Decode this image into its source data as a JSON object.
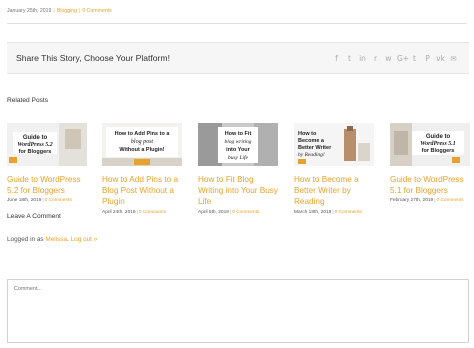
{
  "post_meta": {
    "date": "January 25th, 2019",
    "category": "Blogging",
    "comments": "0 Comments"
  },
  "share": {
    "title": "Share This Story, Choose Your Platform!",
    "icons": [
      "facebook-icon",
      "twitter-icon",
      "linkedin-icon",
      "reddit-icon",
      "whatsapp-icon",
      "google-plus-icon",
      "tumblr-icon",
      "pinterest-icon",
      "vk-icon",
      "email-icon"
    ],
    "icon_glyphs": [
      "f",
      "t",
      "in",
      "r",
      "w",
      "G+",
      "t",
      "P",
      "vk",
      "✉"
    ]
  },
  "related": {
    "title": "Related Posts",
    "posts": [
      {
        "title": "Guide to WordPress 5.2 for Bloggers",
        "date": "June 18th, 2019",
        "comments": "0 Comments",
        "thumb_lines": [
          "Guide to",
          "WordPress 5.2",
          "for Bloggers"
        ]
      },
      {
        "title": "How to Add Pins to a Blog Post Without a Plugin",
        "date": "April 24th, 2019",
        "comments": "0 Comments",
        "thumb_lines": [
          "How to Add Pins to a",
          "blog post",
          "Without a Plugin!"
        ]
      },
      {
        "title": "How to Fit Blog Writing into Your Busy Life",
        "date": "April 5th, 2019",
        "comments": "0 Comments",
        "thumb_lines": [
          "How to Fit",
          "blog writing",
          "into Your",
          "busy Life"
        ]
      },
      {
        "title": "How to Become a Better Writer by Reading",
        "date": "March 18th, 2019",
        "comments": "0 Comments",
        "thumb_lines": [
          "How to",
          "Become a",
          "Better Writer",
          "by Reading!"
        ]
      },
      {
        "title": "Guide to WordPress 5.1 for Bloggers",
        "date": "February 27th, 2019",
        "comments": "0 Comments",
        "thumb_lines": [
          "Guide to",
          "WordPress 5.1",
          "for Bloggers"
        ]
      }
    ]
  },
  "comment": {
    "title": "Leave A Comment",
    "logged_prefix": "Logged in as ",
    "user": "Melissa",
    "logout": "Log out »",
    "placeholder": "Comment..."
  },
  "colors": {
    "accent": "#e8a22c",
    "icon_gray": "#a9a9a9",
    "share_bg": "#f6f6f6"
  }
}
